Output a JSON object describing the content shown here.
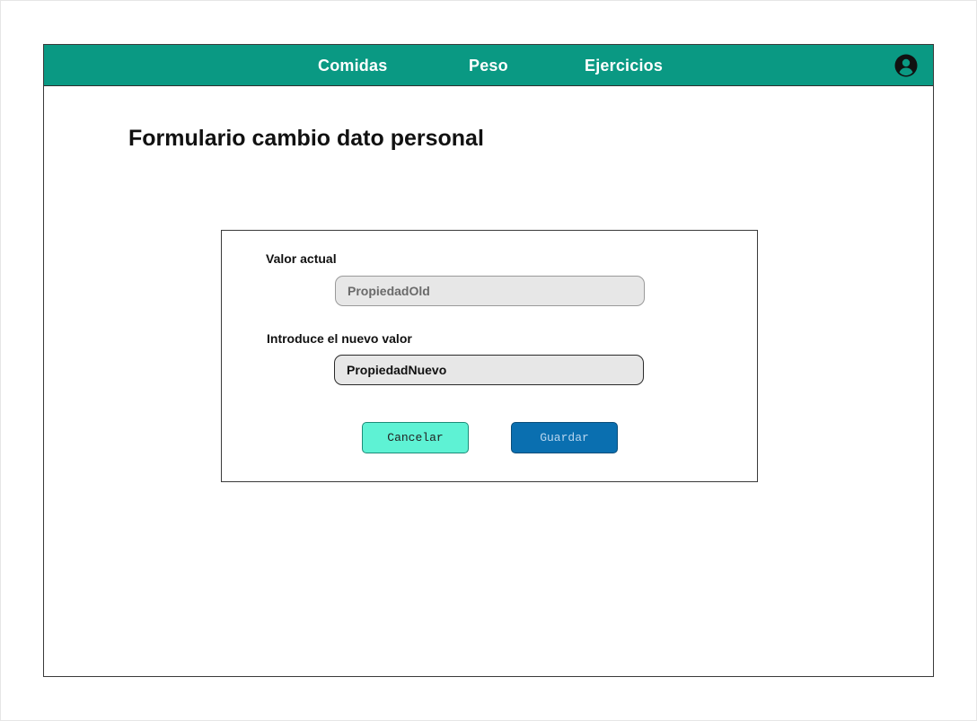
{
  "nav": {
    "items": [
      {
        "label": "Comidas"
      },
      {
        "label": "Peso"
      },
      {
        "label": "Ejercicios"
      }
    ],
    "user_icon": "user-circle-icon"
  },
  "page": {
    "title": "Formulario cambio dato personal"
  },
  "form": {
    "current_label": "Valor actual",
    "current_value": "PropiedadOld",
    "new_label": "Introduce el nuevo valor",
    "new_value": "PropiedadNuevo",
    "cancel_label": "Cancelar",
    "save_label": "Guardar"
  },
  "colors": {
    "navbar": "#0a9983",
    "cancel_button": "#5ef2d4",
    "save_button": "#0a6fb0"
  }
}
